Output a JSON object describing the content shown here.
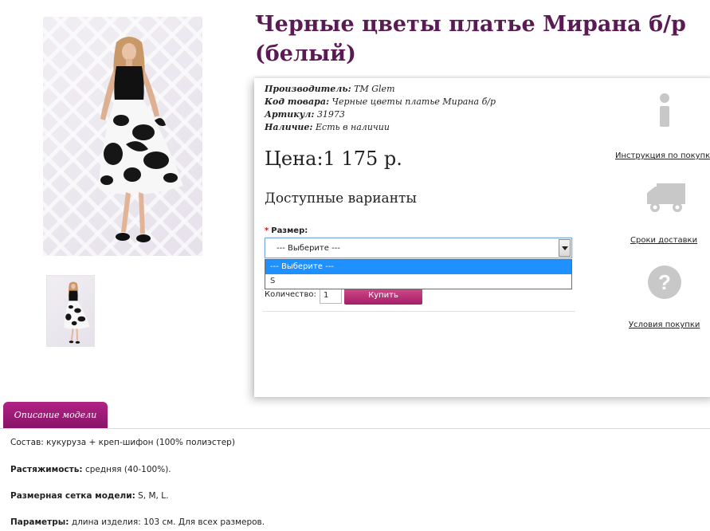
{
  "product": {
    "title": "Черные цветы платье Мирана б/р (белый)",
    "manufacturer_label": "Производитель:",
    "manufacturer": "TM Glem",
    "code_label": "Код товара:",
    "code": "Черные цветы платье Мирана б/р",
    "sku_label": "Артикул:",
    "sku": "31973",
    "availability_label": "Наличие:",
    "availability": "Есть в наличии",
    "price": "Цена:1 175 р."
  },
  "options": {
    "heading": "Доступные варианты",
    "size_label": "Размер:",
    "required_mark": "*",
    "size_selected": "--- Выберите ---",
    "size_options": [
      "--- Выберите ---",
      "S"
    ]
  },
  "cart": {
    "qty_label": "Количество:",
    "qty_value": "1",
    "buy_label": "Купить"
  },
  "side": {
    "instructions_link": "Инструкция по покупке",
    "delivery_link": "Сроки доставки",
    "terms_link": "Условия покупки"
  },
  "tabs": {
    "description": "Описание модели"
  },
  "description": {
    "composition_label": "Состав:",
    "composition": "кукуруза + креп-шифон (100% полиэстер)",
    "stretch_label": "Растяжимость:",
    "stretch": "средняя (40-100%).",
    "sizes_label": "Размерная сетка модели:",
    "sizes": "S, M, L.",
    "params_label": "Параметры:",
    "params": "длина изделия: 103 см. Для всех размеров."
  },
  "colors": {
    "title": "#5a1b54",
    "accent": "#a51f69",
    "select_highlight": "#1e90ff"
  }
}
